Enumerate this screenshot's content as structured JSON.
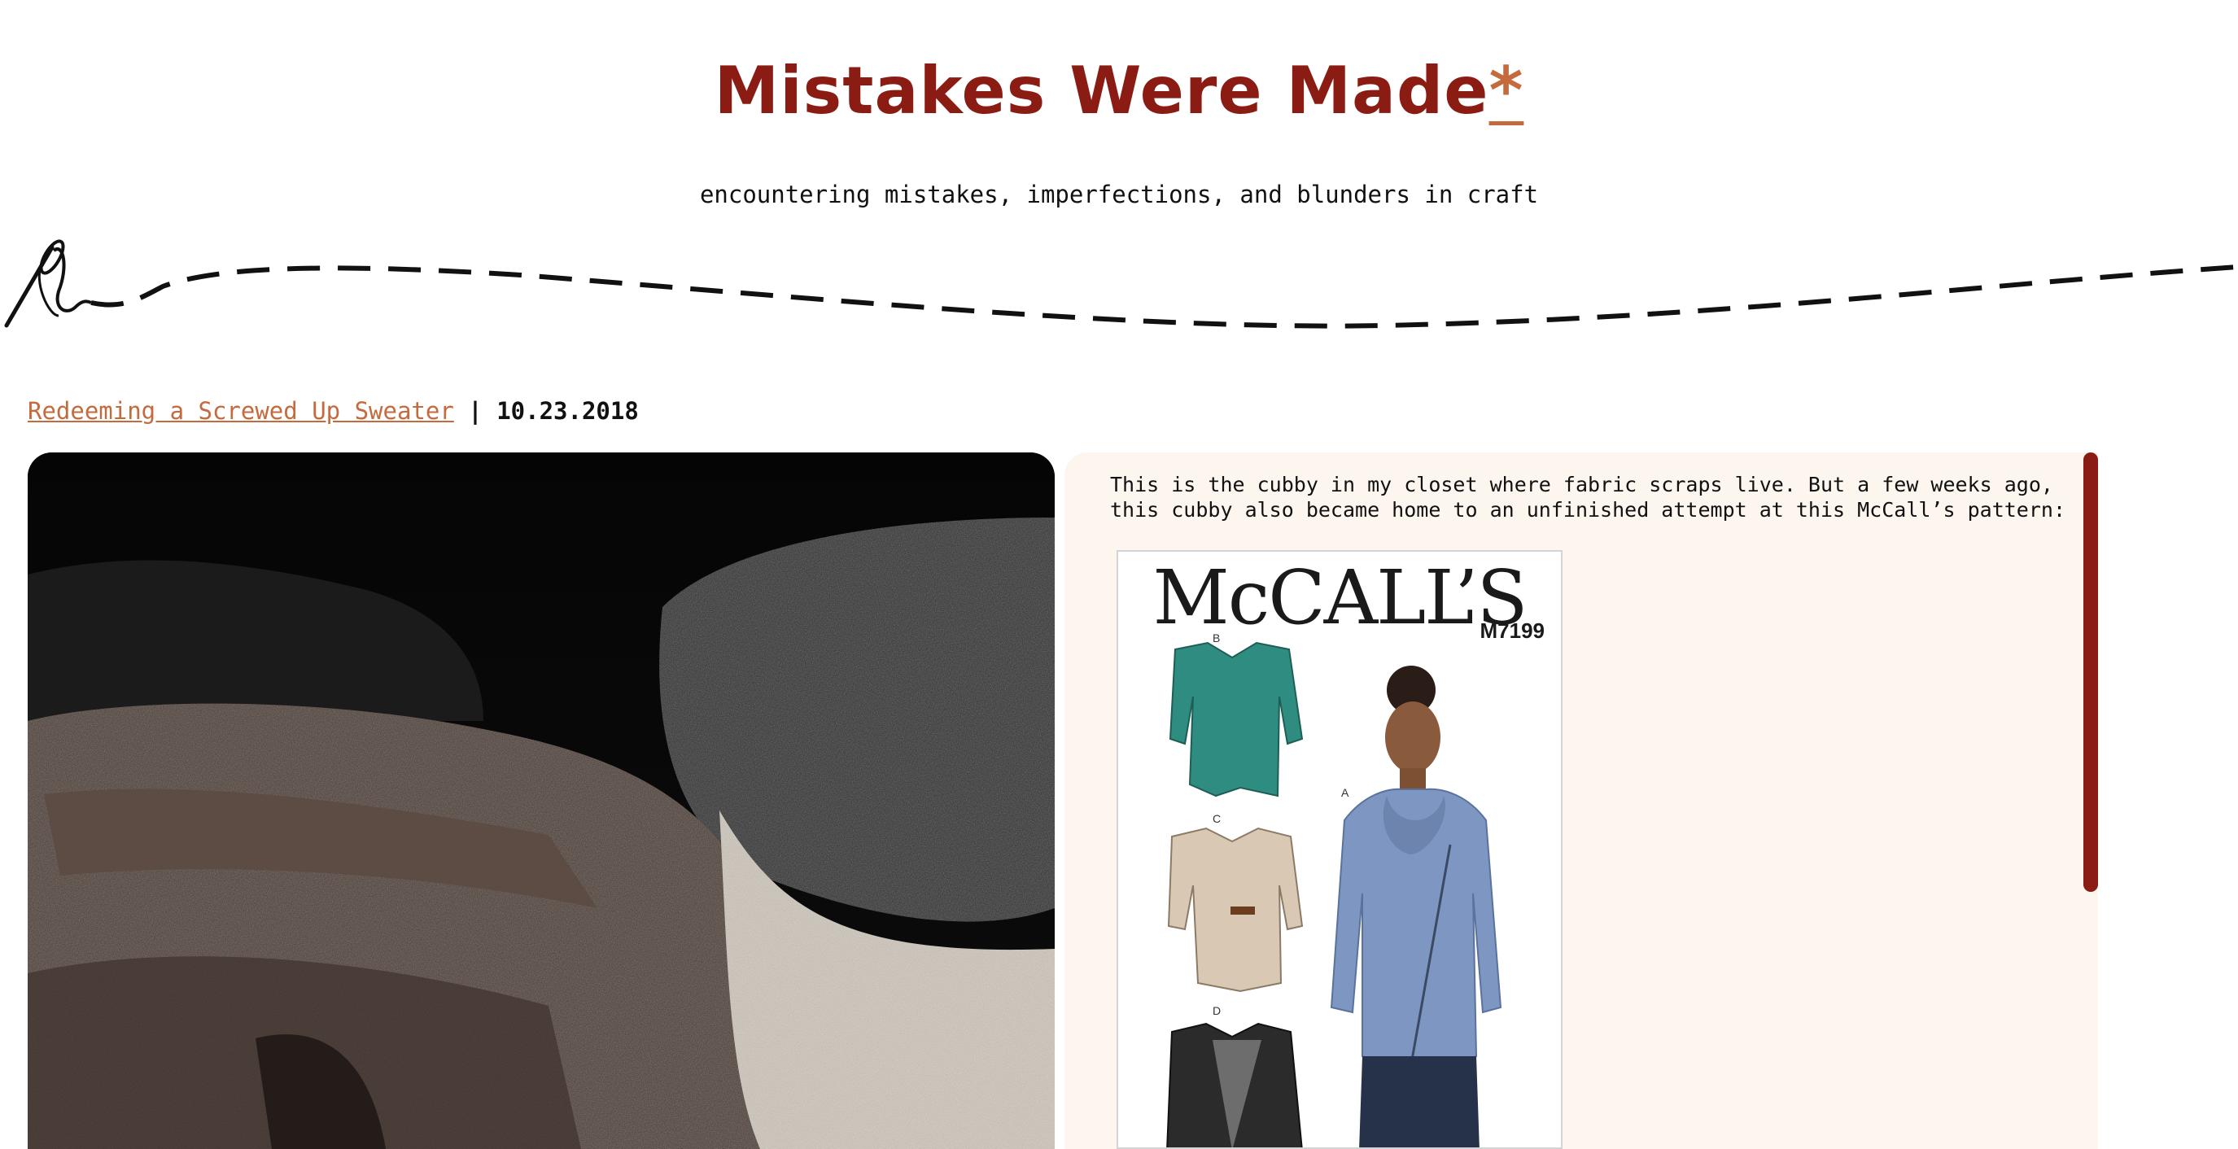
{
  "header": {
    "title": "Mistakes Were Made",
    "title_asterisk": "*",
    "tagline": "encountering mistakes, imperfections, and blunders in craft"
  },
  "post": {
    "title_link": "Redeeming a Screwed Up Sweater",
    "separator": "|",
    "date": "10.23.2018",
    "paragraph": "This is the cubby in my closet where fabric scraps live. But a few weeks ago, this cubby also became home to an unfinished attempt at this McCall’s pattern:",
    "pattern_image": {
      "brand": "McCALL’S",
      "pattern_number": "M7199",
      "view_labels": [
        "B",
        "C",
        "D",
        "A"
      ]
    }
  },
  "colors": {
    "title": "#8b1c13",
    "accent": "#c56a3d",
    "panel_bg": "#fdf6ee",
    "scrollbar": "#8b1c13"
  },
  "icons": {
    "divider": "needle-and-thread-icon"
  }
}
